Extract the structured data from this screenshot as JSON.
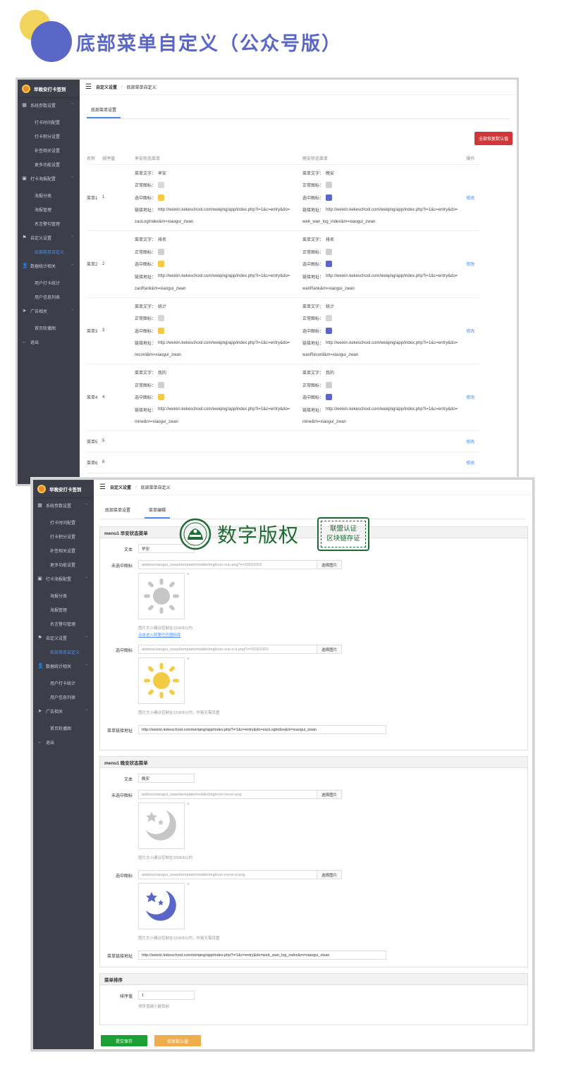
{
  "header": {
    "title": "底部菜单自定义（公众号版）",
    "colors": {
      "yellow": "#f2d45c",
      "blue": "#5a67c6"
    }
  },
  "sidebar": {
    "brand": "早晚安打卡签到",
    "items": [
      {
        "label": "系统参数设置",
        "type": "group",
        "icon": "grid-icon"
      },
      {
        "label": "打卡时间配置",
        "type": "sub"
      },
      {
        "label": "打卡积分设置",
        "type": "sub"
      },
      {
        "label": "补签相关设置",
        "type": "sub"
      },
      {
        "label": "更多功能设置",
        "type": "sub"
      },
      {
        "label": "打卡海报配置",
        "type": "group",
        "icon": "image-icon"
      },
      {
        "label": "海报分类",
        "type": "sub"
      },
      {
        "label": "海报管理",
        "type": "sub"
      },
      {
        "label": "名言警句管理",
        "type": "sub"
      },
      {
        "label": "自定义设置",
        "type": "group",
        "icon": "flag-icon"
      },
      {
        "label": "底部菜单自定义",
        "type": "sub",
        "active": true
      },
      {
        "label": "数据统计相关",
        "type": "group",
        "icon": "user-icon"
      },
      {
        "label": "用户打卡统计",
        "type": "sub"
      },
      {
        "label": "用户信息列表",
        "type": "sub"
      },
      {
        "label": "广告相关",
        "type": "group",
        "icon": "send-icon"
      },
      {
        "label": "首页轮播图",
        "type": "sub"
      },
      {
        "label": "退出",
        "type": "group",
        "icon": "logout-icon"
      }
    ]
  },
  "breadcrumb": {
    "root": "自定义设置",
    "sep": "/",
    "current": "底部菜单自定义"
  },
  "list_page": {
    "tab": "底部菜单设置",
    "reset_all": "全部恢复默认值",
    "columns": [
      "名称",
      "排序值",
      "早安状态菜单",
      "晚安状态菜单",
      "操作"
    ],
    "labels": {
      "text": "菜单文字：",
      "normal": "正常图标：",
      "selected": "选中图标：",
      "link": "链接地址："
    },
    "rows": [
      {
        "name": "菜单1",
        "order": "1",
        "m": {
          "text": "早安",
          "link1": "http://weixin.kekeschool.com/weiqing/app/index.php?i=1&c=entry&do=",
          "link2": "zaoLogIndex&m=xiaogui_zwan"
        },
        "e": {
          "text": "晚安",
          "link1": "http://weixin.kekeschool.com/weiqing/app/index.php?i=1&c=entry&do=",
          "link2": "web_wan_log_index&m=xiaogui_zwan"
        },
        "action": "修改",
        "icon": "sun-icon"
      },
      {
        "name": "菜单2",
        "order": "2",
        "m": {
          "text": "排名",
          "link1": "http://weixin.kekeschool.com/weiqing/app/index.php?i=1&c=entry&do=",
          "link2": "zaoRank&m=xiaogui_zwan"
        },
        "e": {
          "text": "排名",
          "link1": "http://weixin.kekeschool.com/weiqing/app/index.php?i=1&c=entry&do=",
          "link2": "wanRank&m=xiaogui_zwan"
        },
        "action": "修改",
        "icon": "trophy-icon"
      },
      {
        "name": "菜单3",
        "order": "3",
        "m": {
          "text": "统计",
          "link1": "http://weixin.kekeschool.com/weiqing/app/index.php?i=1&c=entry&do=",
          "link2": "record&m=xiaogui_zwan"
        },
        "e": {
          "text": "统计",
          "link1": "http://weixin.kekeschool.com/weiqing/app/index.php?i=1&c=entry&do=",
          "link2": "wanRecord&m=xiaogui_zwan"
        },
        "action": "修改",
        "icon": "chart-icon"
      },
      {
        "name": "菜单4",
        "order": "4",
        "m": {
          "text": "我的",
          "link1": "http://weixin.kekeschool.com/weiqing/app/index.php?i=1&c=entry&do=",
          "link2": "mine&m=xiaogui_zwan"
        },
        "e": {
          "text": "我的",
          "link1": "http://weixin.kekeschool.com/weiqing/app/index.php?i=1&c=entry&do=",
          "link2": "mine&m=xiaogui_zwan"
        },
        "action": "修改",
        "icon": "person-icon"
      },
      {
        "name": "菜单5",
        "order": "5",
        "action": "修改"
      },
      {
        "name": "菜单6",
        "order": "6",
        "action": "修改"
      }
    ]
  },
  "edit_page": {
    "tabs": [
      "底部菜单设置",
      "菜单编辑"
    ],
    "morning": {
      "title": "menu1 早安状态菜单",
      "text_label": "文本",
      "text_value": "早安",
      "normal_label": "未选中图标",
      "normal_value": "addons/xiaogui_zwan/template/mobile/img/icon-sun.png?v=20201003",
      "pick": "选择图片",
      "hint1": "图片大小建议控制在100KB以内",
      "link_hint": "点击进入阿里巴巴图标库",
      "selected_label": "选中图标",
      "selected_value": "addons/xiaogui_zwan/template/mobile/img/icon-sun-z-d.png?v=20201003",
      "hint2": "图片大小建议控制在100KB以内，外链无需设置",
      "url_label": "菜单链接地址",
      "url_value": "http://weixin.kekeschool.com/weiqing/app/index.php?i=1&c=entry&do=zaoLogIndex&m=xiaogui_zwan"
    },
    "evening": {
      "title": "menu1 晚安状态菜单",
      "text_label": "文本",
      "text_value": "晚安",
      "normal_label": "未选中图标",
      "normal_value": "addons/xiaogui_zwan/template/mobile/img/icon-moon.png",
      "pick": "选择图片",
      "hint1": "图片大小建议控制在100KB以内",
      "selected_label": "选中图标",
      "selected_value": "addons/xiaogui_zwan/template/mobile/img/icon-moon-d.png",
      "hint2": "图片大小建议控制在100KB以内，外链无需设置",
      "url_label": "菜单链接地址",
      "url_value": "http://weixin.kekeschool.com/weiqing/app/index.php?i=1&c=entry&do=web_wan_log_index&m=xiaogui_zwan"
    },
    "sort": {
      "title": "菜单排序",
      "label": "排序值",
      "value": "1",
      "hint": "排序值越小越靠前"
    },
    "save": "提交保存",
    "reset": "恢复默认值"
  },
  "watermark": {
    "text": "数字版权",
    "stamp1": "联盟认证",
    "stamp2": "区块链存证"
  }
}
